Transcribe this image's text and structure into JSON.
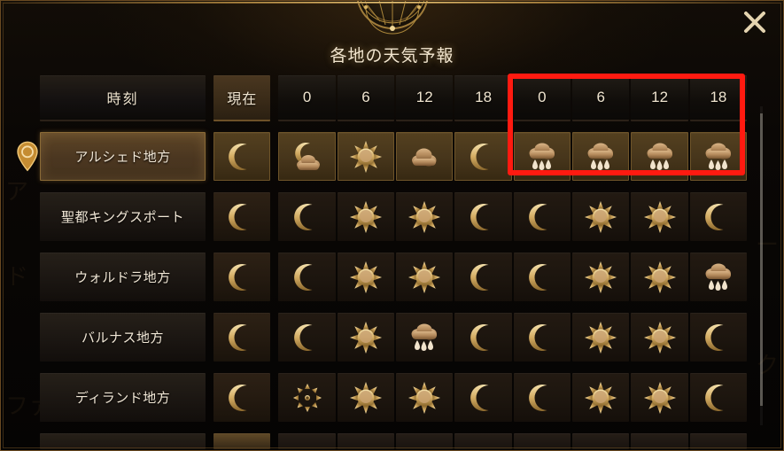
{
  "window": {
    "title": "各地の天気予報",
    "close_label": "×",
    "emblem_name": "sun-moon-crest"
  },
  "table": {
    "headers": {
      "name_col": "時刻",
      "now_col": "現在",
      "day1": [
        "0",
        "6",
        "12",
        "18"
      ],
      "day2": [
        "0",
        "6",
        "12",
        "18"
      ]
    },
    "rows": [
      {
        "name": "アルシェド地方",
        "current_location": true,
        "now": "moon",
        "forecast": [
          "cloudy-moon",
          "sun",
          "cloud",
          "moon",
          "rain",
          "rain",
          "rain",
          "rain"
        ]
      },
      {
        "name": "聖都キングスポート",
        "current_location": false,
        "now": "moon",
        "forecast": [
          "moon",
          "sun",
          "sun",
          "moon",
          "moon",
          "sun",
          "sun",
          "moon"
        ]
      },
      {
        "name": "ウォルドラ地方",
        "current_location": false,
        "now": "moon",
        "forecast": [
          "moon",
          "sun",
          "sun",
          "moon",
          "moon",
          "sun",
          "sun",
          "rain"
        ]
      },
      {
        "name": "バルナス地方",
        "current_location": false,
        "now": "moon",
        "forecast": [
          "moon",
          "sun",
          "rain",
          "moon",
          "moon",
          "sun",
          "sun",
          "moon"
        ]
      },
      {
        "name": "ディランド地方",
        "current_location": false,
        "now": "moon",
        "forecast": [
          "snow",
          "sun",
          "sun",
          "moon",
          "moon",
          "sun",
          "sun",
          "moon"
        ]
      }
    ]
  },
  "annotation": {
    "highlight_box_color": "#ff1a10",
    "highlight_box_target": "day2-forecast-arshade"
  },
  "icons": {
    "pin": "location-pin-icon",
    "scrollbar": "vertical-scrollbar"
  },
  "colors": {
    "gold": "#c8a05a",
    "gold_light": "#e8c678",
    "panel_bg": "#0a0705",
    "text": "#f1e7d6"
  },
  "background_ghost_text": [
    "ア",
    "ド",
    "ファ",
    "ー",
    "ク"
  ]
}
